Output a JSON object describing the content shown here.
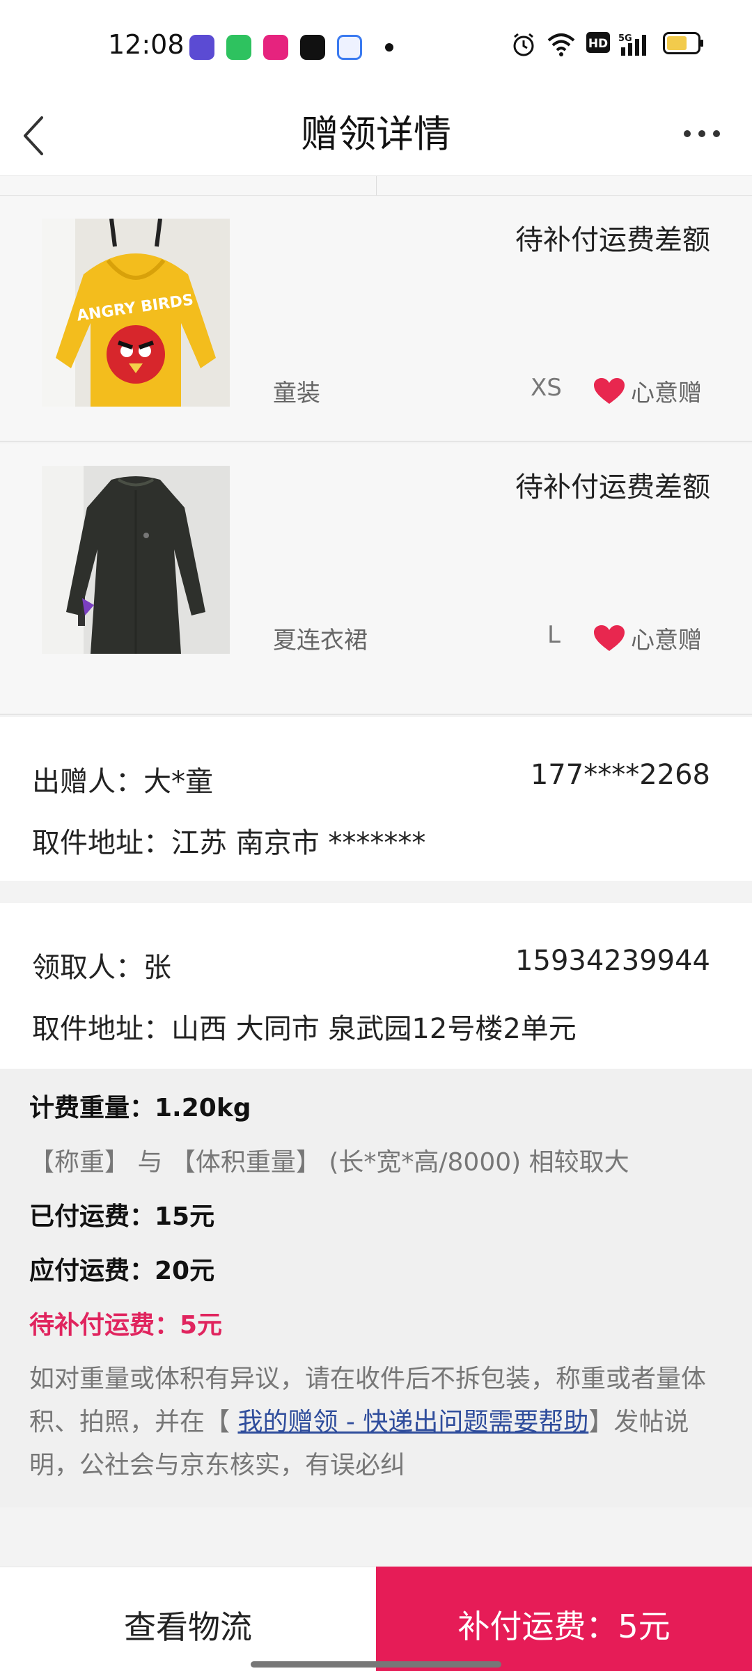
{
  "status_bar": {
    "time": "12:08",
    "network": "5G"
  },
  "header": {
    "title": "赠领详情",
    "back_icon": "chevron-left-icon",
    "more_icon": "more-horizontal-icon"
  },
  "items": [
    {
      "status": "待补付运费差额",
      "name": "童装",
      "size": "XS",
      "tag": "心意赠",
      "image": "yellow-angry-birds-hoodie"
    },
    {
      "status": "待补付运费差额",
      "name": "夏连衣裙",
      "size": "L",
      "tag": "心意赠",
      "image": "dark-green-dress"
    }
  ],
  "giver": {
    "label": "出赠人：大*童",
    "phone": "177****2268",
    "address": "取件地址：江苏 南京市 *******"
  },
  "receiver": {
    "label": "领取人：张",
    "phone": "15934239944",
    "address": "取件地址：山西 大同市 泉武园12号楼2单元"
  },
  "fee": {
    "weight": "计费重量：1.20kg",
    "rule": "【称重】 与 【体积重量】 (长*宽*高/8000) 相较取大",
    "paid": "已付运费：15元",
    "payable": "应付运费：20元",
    "pending": "待补付运费：5元",
    "note_prefix": "如对重量或体积有异议，请在收件后不拆包装，称重或者量体积、拍照，并在【 ",
    "note_link": "我的赠领 - 快递出问题需要帮助",
    "note_suffix": "】发帖说明，公社会与京东核实，有误必纠"
  },
  "actions": {
    "logistics": "查看物流",
    "pay": "补付运费：5元"
  },
  "colors": {
    "accent": "#e61c57",
    "link": "#2f4d9c"
  }
}
